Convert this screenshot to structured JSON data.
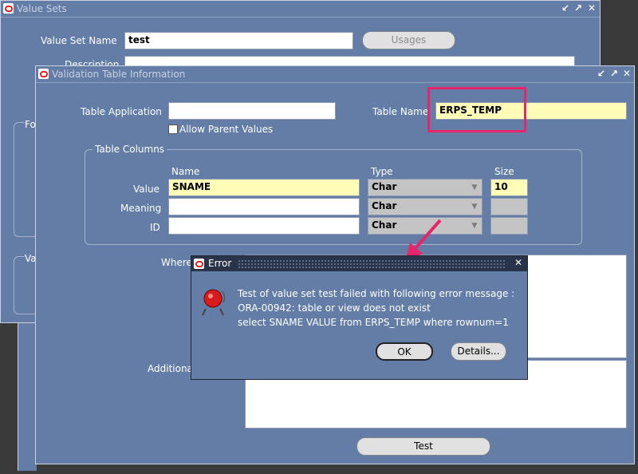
{
  "value_sets_window": {
    "title": "Value Sets",
    "value_set_name_label": "Value Set Name",
    "value_set_name": "test",
    "description_label": "Description",
    "usages_button": "Usages",
    "format_label_partial": "Fo",
    "validation_label_partial": "Va"
  },
  "validation_window": {
    "title": "Validation Table Information",
    "table_application_label": "Table Application",
    "table_application": "",
    "table_name_label": "Table Name",
    "table_name": "ERPS_TEMP",
    "allow_parent_label": "Allow Parent Values",
    "columns_group": "Table Columns",
    "col_name_header": "Name",
    "col_type_header": "Type",
    "col_size_header": "Size",
    "rows": [
      {
        "label": "Value",
        "name": "SNAME",
        "type": "Char",
        "size": "10"
      },
      {
        "label": "Meaning",
        "name": "",
        "type": "Char",
        "size": ""
      },
      {
        "label": "ID",
        "name": "",
        "type": "Char",
        "size": ""
      }
    ],
    "where_label": "Where",
    "additional_label": "Additiona",
    "test_button": "Test"
  },
  "error_dialog": {
    "title": "Error",
    "line1": "Test of value set test failed with following error message :",
    "line2": "ORA-00942: table or view does not exist",
    "line3": "select SNAME VALUE  from ERPS_TEMP where rownum=1",
    "ok_button": "OK",
    "details_button": "Details..."
  },
  "colors": {
    "window_bg": "#637da6",
    "required_field": "#fefcb6",
    "highlight": "#e8246b"
  }
}
